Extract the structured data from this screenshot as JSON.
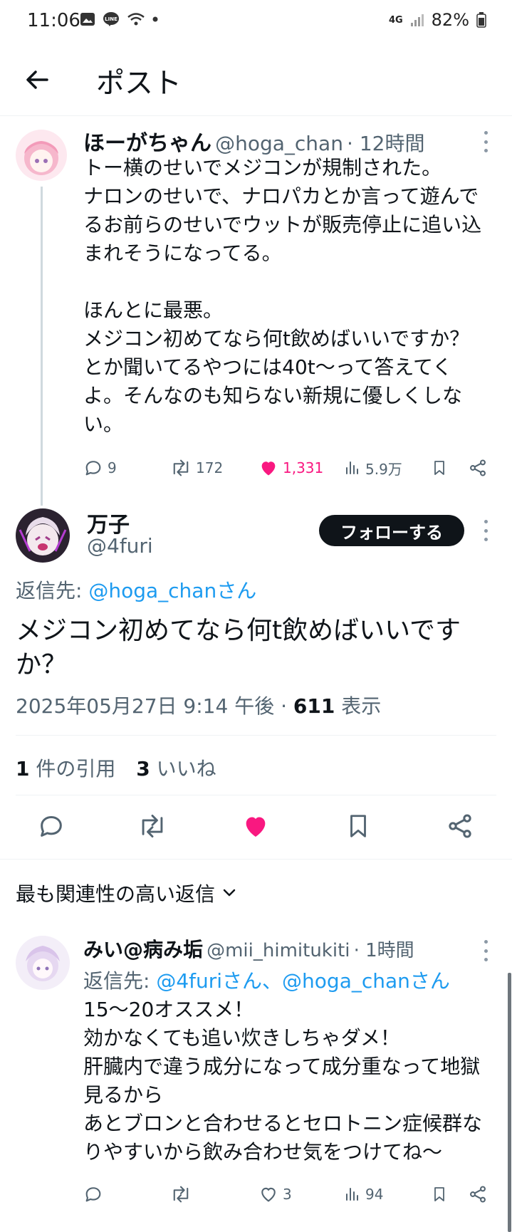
{
  "status_bar": {
    "time": "11:06",
    "network": "4G",
    "battery": "82%"
  },
  "header": {
    "title": "ポスト"
  },
  "parent_post": {
    "name": "ほーがちゃん",
    "handle": "@hoga_chan",
    "time": "· 12時間",
    "text": "トー横のせいでメジコンが規制された。\nナロンのせいで、ナロパカとか言って遊んで\nるお前らのせいでウットが販売停止に追い込\nまれそうになってる。\n\nほんとに最悪。\nメジコン初めてなら何t飲めばいいですか？\nとか聞いてるやつには40t〜って答えてく\nよ。そんなのも知らない新規に優しくしな\nい。",
    "replies": "9",
    "reposts": "172",
    "likes": "1,331",
    "views": "5.9万"
  },
  "main_post": {
    "name": "万子",
    "handle": "@4furi",
    "follow_label": "フォローする",
    "reply_to_prefix": "返信先: ",
    "reply_to": "@hoga_chanさん",
    "text": "メジコン初めてなら何t飲めばいいです\nか？",
    "timestamp": "2025年05月27日 9:14 午後 · ",
    "views": "611",
    "views_label": " 表示",
    "quotes_count": "1",
    "quotes_label": " 件の引用",
    "likes_count": "3",
    "likes_label": " いいね"
  },
  "replies_section": {
    "sort_label": "最も関連性の高い返信"
  },
  "reply_post": {
    "name": "みい@病み垢",
    "handle": "@mii_himitukiti",
    "time": "· 1時間",
    "reply_to_prefix": "返信先: ",
    "reply_to": "@4furiさん、@hoga_chanさん",
    "text": "15〜20オススメ！\n効かなくても追い炊きしちゃダメ！\n肝臓内で違う成分になって成分重なって地獄\n見るから\nあとブロンと合わせるとセロトニン症候群な\nりやすいから飲み合わせ気をつけてね〜",
    "replies": "",
    "reposts": "",
    "likes": "3",
    "views": "94"
  },
  "colors": {
    "accent": "#1d9bf0",
    "like": "#f91880",
    "text": "#0f1419",
    "muted": "#536471"
  }
}
